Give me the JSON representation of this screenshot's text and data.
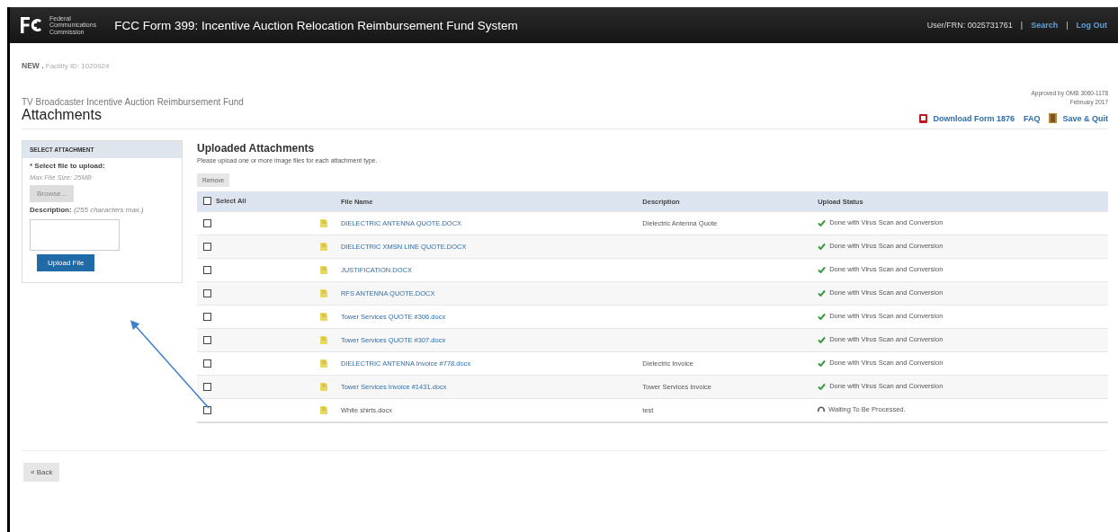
{
  "header": {
    "agency_lines": [
      "Federal",
      "Communications",
      "Commission"
    ],
    "title": "FCC Form 399: Incentive Auction Relocation Reimbursement Fund System",
    "user": "User/FRN: 0025731761",
    "separators": [
      "|",
      "|"
    ],
    "links": [
      "Search",
      "Log Out"
    ]
  },
  "breadcrumb": {
    "status": "NEW .",
    "facility": "Facility ID: 1020924"
  },
  "approval": {
    "lines": [
      "Approved by OMB 3060-1178",
      "February 2017"
    ]
  },
  "page": {
    "subtitle": "TV Broadcaster Incentive Auction Reimbursement Fund",
    "title": "Attachments"
  },
  "actions": [
    {
      "kind": "pdf",
      "label": "Download Form 1876"
    },
    {
      "kind": "plain",
      "label": "FAQ"
    },
    {
      "kind": "door",
      "label": "Save & Quit"
    }
  ],
  "select_panel": {
    "heading": "SELECT ATTACHMENT",
    "file_label": "* Select file to upload:",
    "max_size": "Max File Size: 25MB",
    "browse": "Browse...",
    "description_label": "Description:",
    "description_hint": "(255 characters max.)",
    "upload": "Upload File"
  },
  "uploaded": {
    "title": "Uploaded Attachments",
    "instructions": "Please upload one or more image files for each attachment type.",
    "remove": "Remove",
    "select_all": {
      "label": "Select All",
      "checked": false
    },
    "columns": [
      "File Name",
      "Description",
      "Upload Status"
    ],
    "rows": [
      {
        "checked": false,
        "file": "DIELECTRIC ANTENNA QUOTE.DOCX",
        "link": true,
        "description": "Dielectric Antenna Quote",
        "status": "Done with Virus Scan and Conversion",
        "kind": "done"
      },
      {
        "checked": false,
        "file": "DIELECTRIC XMSN LINE QUOTE.DOCX",
        "link": true,
        "status": "Done with Virus Scan and Conversion",
        "kind": "done"
      },
      {
        "checked": false,
        "file": "JUSTIFICATION.DOCX",
        "link": true,
        "status": "Done with Virus Scan and Conversion",
        "kind": "done"
      },
      {
        "checked": false,
        "file": "RFS ANTENNA QUOTE.DOCX",
        "link": true,
        "status": "Done with Virus Scan and Conversion",
        "kind": "done"
      },
      {
        "checked": false,
        "file": "Tower Services QUOTE #306.docx",
        "link": true,
        "status": "Done with Virus Scan and Conversion",
        "kind": "done"
      },
      {
        "checked": false,
        "file": "Tower Services QUOTE #307.docx",
        "link": true,
        "status": "Done with Virus Scan and Conversion",
        "kind": "done"
      },
      {
        "checked": false,
        "file": "DIELECTRIC ANTENNA Invoice #778.docx",
        "link": true,
        "description": "Dielectric Invoice",
        "status": "Done with Virus Scan and Conversion",
        "kind": "done"
      },
      {
        "checked": false,
        "file": "Tower Services Invoice #1431.docx",
        "link": true,
        "description": "Tower Services Invoice",
        "status": "Done with Virus Scan and Conversion",
        "kind": "done"
      },
      {
        "checked": false,
        "file": "White shirts.docx",
        "link": false,
        "description": "test",
        "status": "Waiting To Be Processed.",
        "kind": "waiting"
      }
    ]
  },
  "back": "« Back"
}
